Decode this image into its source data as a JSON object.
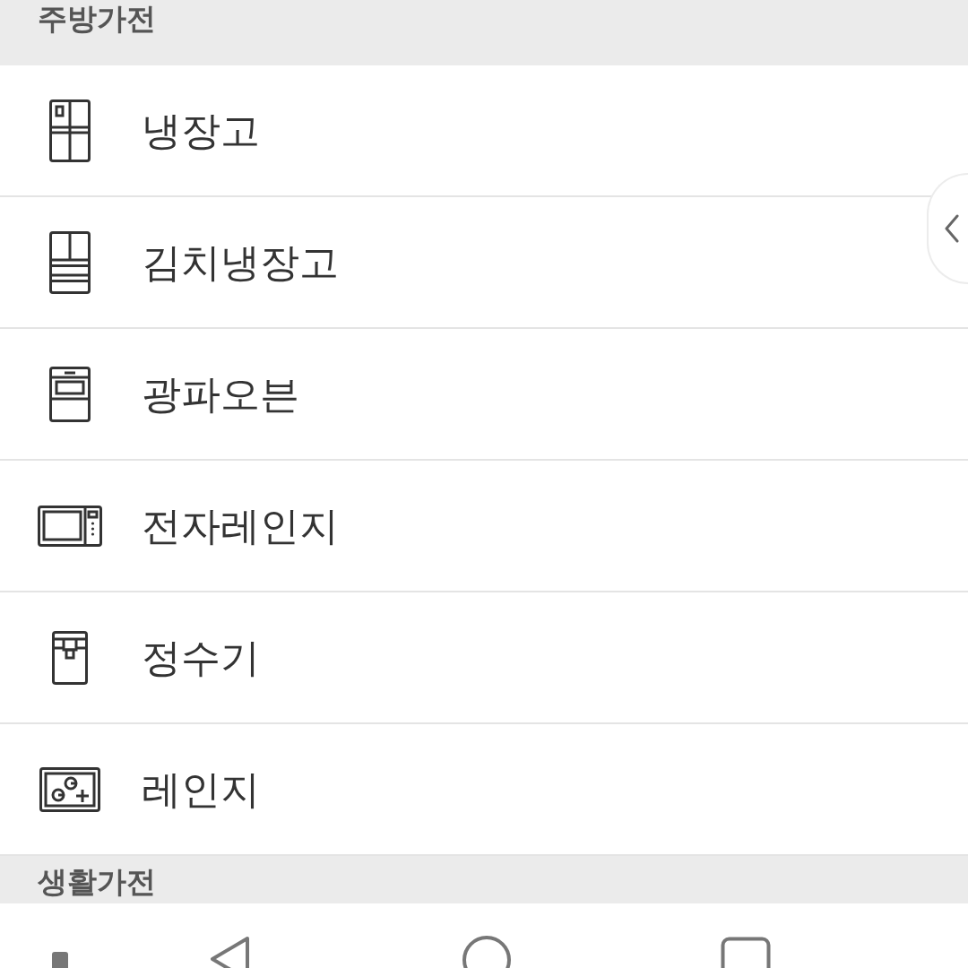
{
  "sections": [
    {
      "title": "주방가전",
      "items": [
        {
          "kind": "fridge",
          "label": "냉장고"
        },
        {
          "kind": "kimchi_fridge",
          "label": "김치냉장고"
        },
        {
          "kind": "oven",
          "label": "광파오븐"
        },
        {
          "kind": "microwave",
          "label": "전자레인지"
        },
        {
          "kind": "purifier",
          "label": "정수기"
        },
        {
          "kind": "cooktop",
          "label": "레인지"
        }
      ]
    },
    {
      "title": "생활가전"
    }
  ]
}
